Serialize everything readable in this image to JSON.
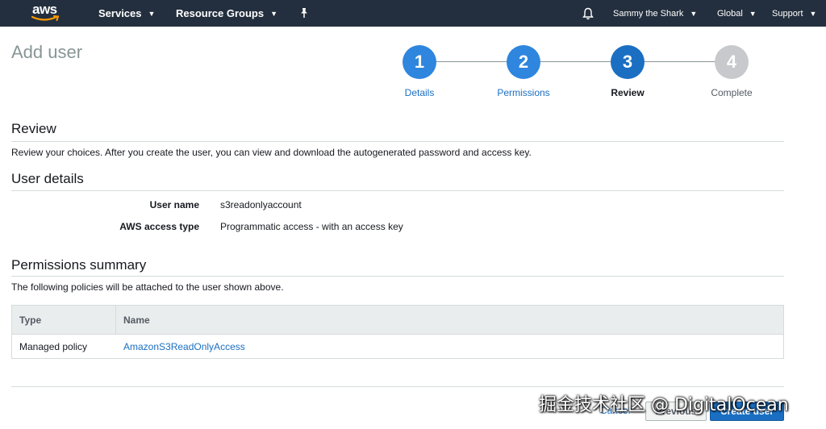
{
  "nav": {
    "logo": "aws",
    "services": "Services",
    "resource_groups": "Resource Groups",
    "user": "Sammy the Shark",
    "region": "Global",
    "support": "Support"
  },
  "page": {
    "title": "Add user"
  },
  "stepper": {
    "steps": [
      {
        "number": "1",
        "label": "Details"
      },
      {
        "number": "2",
        "label": "Permissions"
      },
      {
        "number": "3",
        "label": "Review"
      },
      {
        "number": "4",
        "label": "Complete"
      }
    ]
  },
  "review": {
    "title": "Review",
    "description": "Review your choices. After you create the user, you can view and download the autogenerated password and access key."
  },
  "user_details": {
    "title": "User details",
    "user_name_label": "User name",
    "user_name_value": "s3readonlyaccount",
    "access_type_label": "AWS access type",
    "access_type_value": "Programmatic access - with an access key"
  },
  "permissions": {
    "title": "Permissions summary",
    "description": "The following policies will be attached to the user shown above.",
    "columns": [
      "Type",
      "Name"
    ],
    "rows": [
      {
        "type": "Managed policy",
        "name": "AmazonS3ReadOnlyAccess"
      }
    ]
  },
  "footer": {
    "cancel": "Cancel",
    "previous": "Previous",
    "create": "Create user"
  },
  "watermark": "掘金技术社区 @ DigitalOcean",
  "colors": {
    "nav_bg": "#232f3e",
    "accent": "#1b6fc2",
    "step_done": "#2e86de",
    "step_todo": "#c7c9cc"
  }
}
